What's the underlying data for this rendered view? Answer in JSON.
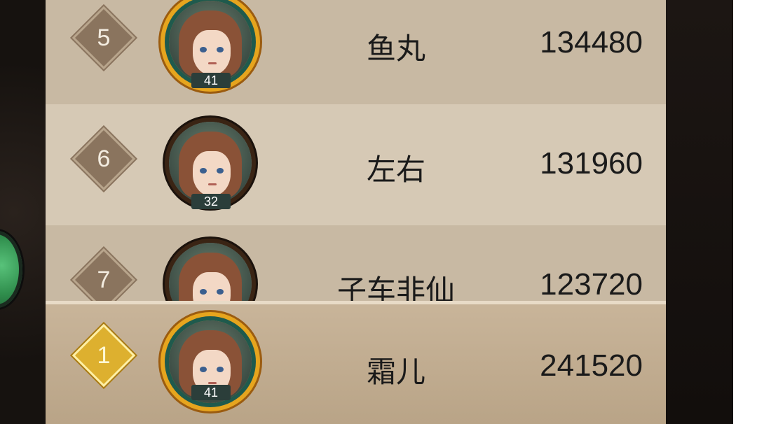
{
  "leaderboard": {
    "rows": [
      {
        "rank": "5",
        "level": "41",
        "name": "鱼丸",
        "score": "134480"
      },
      {
        "rank": "6",
        "level": "32",
        "name": "左右",
        "score": "131960"
      },
      {
        "rank": "7",
        "level": "",
        "name": "子车非仙",
        "score": "123720"
      }
    ],
    "self": {
      "rank": "1",
      "level": "41",
      "name": "霜儿",
      "score": "241520"
    }
  },
  "colors": {
    "panel": "#c8b9a3",
    "panel_alt": "#d6c9b5",
    "rank_badge": "#8a745e",
    "gold_badge": "#ddb02f"
  }
}
